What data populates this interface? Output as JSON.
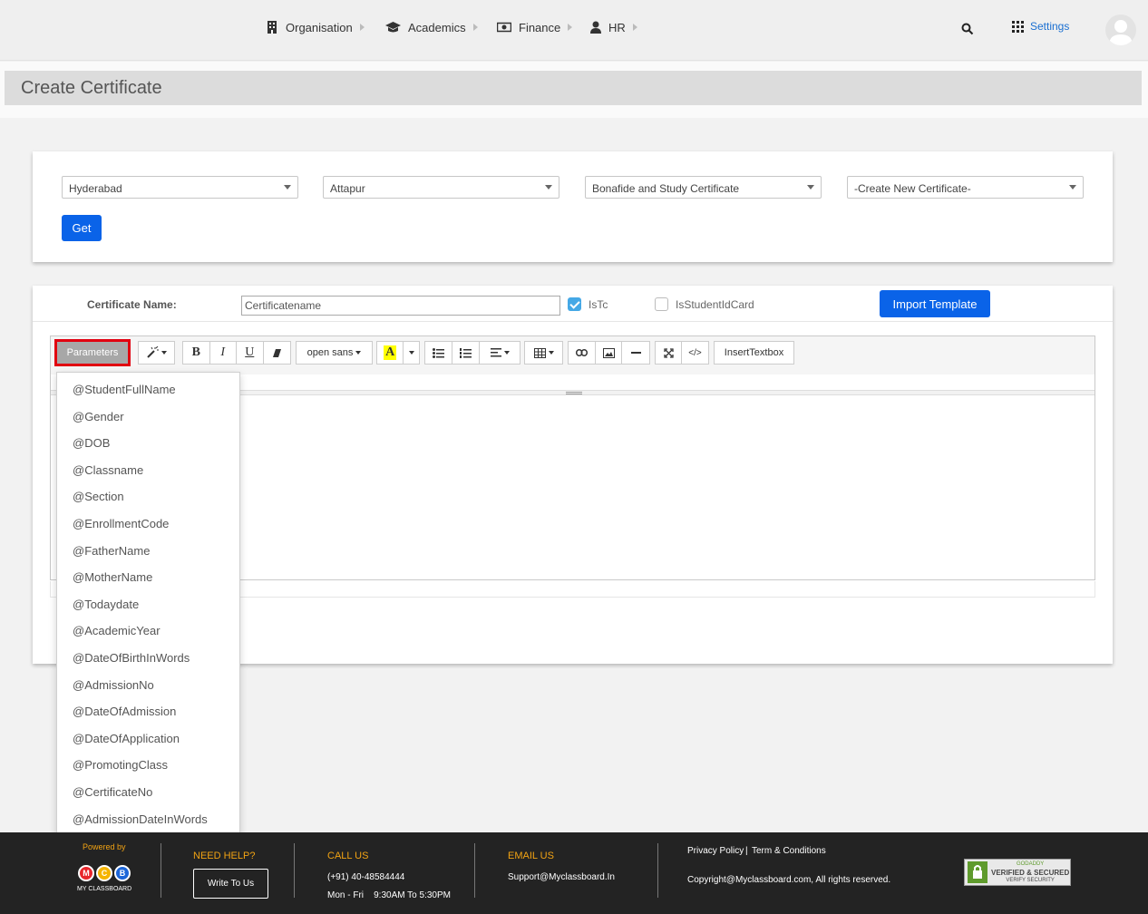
{
  "nav": {
    "items": [
      {
        "label": "Organisation",
        "icon": "building-icon"
      },
      {
        "label": "Academics",
        "icon": "graduation-cap-icon"
      },
      {
        "label": "Finance",
        "icon": "money-icon"
      },
      {
        "label": "HR",
        "icon": "user-icon"
      }
    ],
    "settings_label": "Settings"
  },
  "page": {
    "title": "Create Certificate"
  },
  "filters": {
    "city": "Hyderabad",
    "branch": "Attapur",
    "certificate_type": "Bonafide and Study Certificate",
    "certificate": "-Create New Certificate-",
    "get_label": "Get"
  },
  "form": {
    "name_label": "Certificate Name:",
    "name_placeholder": "Certificatename",
    "istc_label": "IsTc",
    "istc_checked": true,
    "isstudentidcard_label": "IsStudentIdCard",
    "isstudentidcard_checked": false,
    "import_label": "Import Template"
  },
  "toolbar": {
    "parameters_label": "Parameters",
    "font_label": "open sans",
    "insert_textbox_label": "InsertTextbox"
  },
  "parameters": [
    "@StudentFullName",
    "@Gender",
    "@DOB",
    "@Classname",
    "@Section",
    "@EnrollmentCode",
    "@FatherName",
    "@MotherName",
    "@Todaydate",
    "@AcademicYear",
    "@DateOfBirthInWords",
    "@AdmissionNo",
    "@DateOfAdmission",
    "@DateOfApplication",
    "@PromotingClass",
    "@CertificateNo",
    "@AdmissionDateInWords"
  ],
  "footer": {
    "powered_by": "Powered by",
    "brand": "MY CLASSBOARD",
    "brand_letters": [
      "M",
      "C",
      "B"
    ],
    "need_help": "NEED HELP?",
    "write_to_us": "Write To Us",
    "call_us": "CALL US",
    "phone": "(+91) 40-48584444",
    "hours": "Mon - Fri    9:30AM To 5:30PM",
    "email_us": "EMAIL US",
    "email": "Support@Myclassboard.In",
    "privacy": "Privacy Policy",
    "terms": "Term & Conditions",
    "copyright": "Copyright@Myclassboard.com, All rights reserved.",
    "seal_line1": "GODADDY",
    "seal_line2": "VERIFIED & SECURED",
    "seal_line3": "VERIFY SECURITY"
  },
  "colors": {
    "primary": "#0a63e8",
    "accent": "#f2a313",
    "highlight": "#e10010"
  }
}
